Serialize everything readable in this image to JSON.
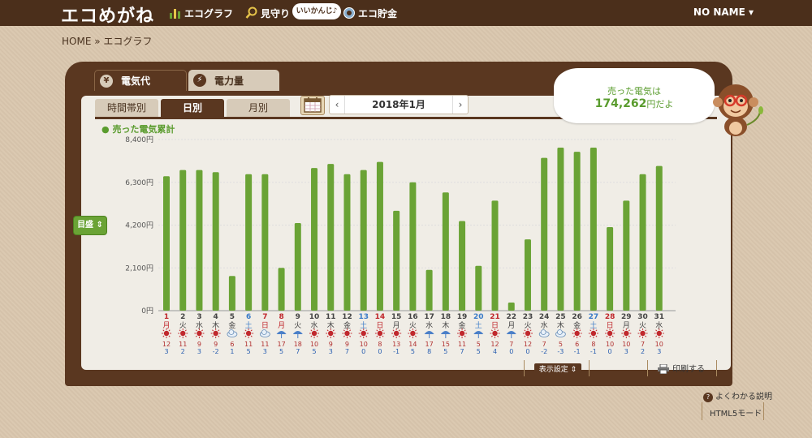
{
  "header": {
    "logo": "エコめがね",
    "nav": [
      {
        "label": "エコグラフ",
        "icon": "bar-chart-icon"
      },
      {
        "label": "見守り",
        "icon": "magnifier-icon"
      },
      {
        "label": "エコ貯金",
        "icon": "coin-icon"
      }
    ],
    "mimamori_badge": "いいかんじ♪",
    "user": "NO NAME ▾"
  },
  "breadcrumb": "HOME » エコグラフ",
  "tabs": {
    "denkidai": "電気代",
    "denkidai_icon": "¥",
    "denryoku": "電力量",
    "denryoku_icon": "⚡"
  },
  "subtabs": [
    "時間帯別",
    "日別",
    "月別"
  ],
  "date_nav": {
    "label": "2018年1月",
    "prev": "‹",
    "next": "›"
  },
  "bubble": {
    "title": "売った電気は",
    "amount": "174,262",
    "unit": "円だよ"
  },
  "scale_button": "目盛 ⇕",
  "controls": {
    "display_settings": "表示設定 ⇕",
    "print": "印刷する",
    "help": "よくわかる説明",
    "html5": "HTML5モード"
  },
  "colors": {
    "bar": "#6aa335",
    "header": "#4b2f1b",
    "panel": "#5a3720",
    "sat": "#3a7bc8",
    "sun": "#c0282d"
  },
  "chart_data": {
    "type": "bar",
    "title": "",
    "legend": "売った電気累計",
    "ylim": [
      0,
      8400
    ],
    "yticks": [
      "0円",
      "2,100円",
      "4,200円",
      "6,300円",
      "8,400円"
    ],
    "ytick_values": [
      0,
      2100,
      4200,
      6300,
      8400
    ],
    "days": [
      "1",
      "2",
      "3",
      "4",
      "5",
      "6",
      "7",
      "8",
      "9",
      "10",
      "11",
      "12",
      "13",
      "14",
      "15",
      "16",
      "17",
      "18",
      "19",
      "20",
      "21",
      "22",
      "23",
      "24",
      "25",
      "26",
      "27",
      "28",
      "29",
      "30",
      "31"
    ],
    "weekdays": [
      "月",
      "火",
      "水",
      "木",
      "金",
      "土",
      "日",
      "月",
      "火",
      "水",
      "木",
      "金",
      "土",
      "日",
      "月",
      "火",
      "水",
      "木",
      "金",
      "土",
      "日",
      "月",
      "火",
      "水",
      "木",
      "金",
      "土",
      "日",
      "月",
      "火",
      "水"
    ],
    "holiday_days": [
      1,
      7,
      8,
      14,
      21,
      28
    ],
    "saturday_days": [
      6,
      13,
      20,
      27
    ],
    "values": [
      6600,
      6900,
      6900,
      6800,
      1700,
      6700,
      6700,
      2100,
      4300,
      7000,
      7200,
      6700,
      6900,
      7300,
      4900,
      6300,
      2000,
      5800,
      4400,
      2200,
      5400,
      400,
      3500,
      7500,
      8000,
      7800,
      8000,
      4100,
      5400,
      6700,
      7100
    ],
    "weather": [
      "sun",
      "sun",
      "sun",
      "sun",
      "cloud",
      "sun",
      "cloud",
      "rain",
      "rain",
      "sun",
      "sun",
      "sun",
      "sun",
      "sun",
      "sun",
      "sun",
      "rain",
      "rain",
      "sun",
      "rain",
      "sun",
      "rain",
      "sun",
      "cloud",
      "cloud",
      "sun",
      "sun",
      "sun",
      "sun",
      "sun",
      "sun"
    ],
    "temp_high": [
      "12",
      "11",
      "9",
      "9",
      "6",
      "11",
      "11",
      "17",
      "18",
      "10",
      "9",
      "9",
      "10",
      "8",
      "13",
      "14",
      "17",
      "15",
      "11",
      "5",
      "12",
      "7",
      "12",
      "7",
      "5",
      "6",
      "8",
      "10",
      "10",
      "7",
      "10"
    ],
    "temp_low": [
      "3",
      "2",
      "3",
      "-2",
      "1",
      "5",
      "3",
      "5",
      "7",
      "5",
      "3",
      "7",
      "0",
      "0",
      "-1",
      "5",
      "8",
      "5",
      "7",
      "5",
      "4",
      "0",
      "0",
      "-2",
      "-3",
      "-1",
      "-1",
      "0",
      "3",
      "2",
      "3"
    ]
  }
}
